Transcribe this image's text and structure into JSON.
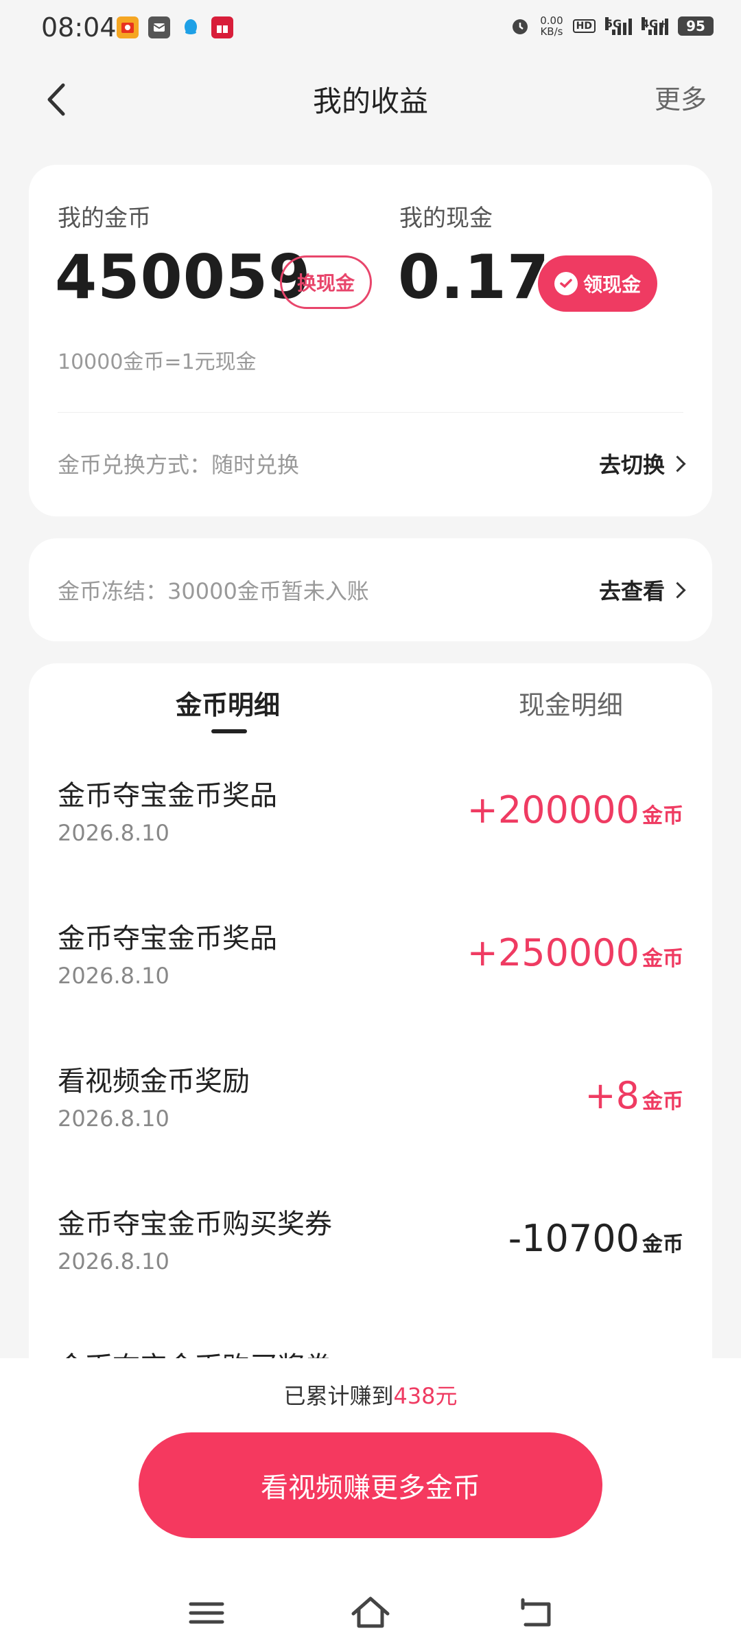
{
  "status_bar": {
    "time": "08:04",
    "net_speed_value": "0.00",
    "net_speed_unit": "KB/s",
    "hd": "HD",
    "sim1": "5G",
    "sim2": "4G+",
    "battery": "95"
  },
  "header": {
    "title": "我的收益",
    "more": "更多"
  },
  "wallet": {
    "coins_label": "我的金币",
    "coins_value": "450059",
    "exchange_button": "换现金",
    "cash_label": "我的现金",
    "cash_value": "0.17",
    "withdraw_button": "领现金",
    "rate_text": "10000金币=1元现金",
    "method_text": "金币兑换方式：随时兑换",
    "method_action": "去切换"
  },
  "freeze": {
    "text": "金币冻结：30000金币暂未入账",
    "action": "去查看"
  },
  "details": {
    "tabs": [
      "金币明细",
      "现金明细"
    ],
    "unit": "金币",
    "transactions": [
      {
        "title": "金币夺宝金币奖品",
        "date": "2026.8.10",
        "amount": "+200000"
      },
      {
        "title": "金币夺宝金币奖品",
        "date": "2026.8.10",
        "amount": "+250000"
      },
      {
        "title": "看视频金币奖励",
        "date": "2026.8.10",
        "amount": "+8"
      },
      {
        "title": "金币夺宝金币购买奖券",
        "date": "2026.8.10",
        "amount": "-10700"
      },
      {
        "title": "金币夺宝金币购买奖券",
        "date": "",
        "amount": ""
      }
    ]
  },
  "footer": {
    "earned_prefix": "已累计赚到",
    "earned_value": "438元",
    "cta": "看视频赚更多金币"
  },
  "colors": {
    "accent": "#ef3b62",
    "text": "#222222",
    "muted": "#999999",
    "bg": "#f5f5f5"
  }
}
